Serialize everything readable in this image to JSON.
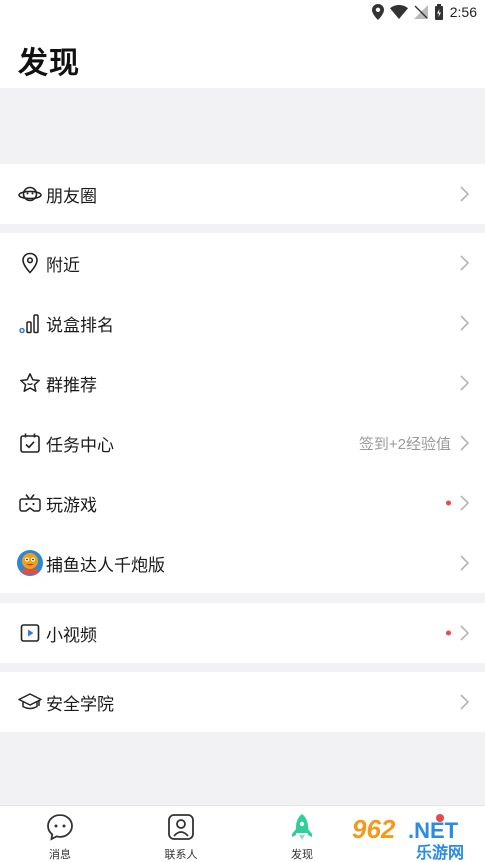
{
  "status_bar": {
    "time": "2:56"
  },
  "header": {
    "title": "发现"
  },
  "sections": [
    {
      "items": [
        {
          "label": "朋友圈",
          "icon": "planet-icon"
        }
      ]
    },
    {
      "items": [
        {
          "label": "附近",
          "icon": "location-pin-icon"
        },
        {
          "label": "说盒排名",
          "icon": "ranking-bars-icon"
        },
        {
          "label": "群推荐",
          "icon": "star-icon"
        },
        {
          "label": "任务中心",
          "icon": "calendar-check-icon",
          "hint": "签到+2经验值"
        },
        {
          "label": "玩游戏",
          "icon": "game-controller-icon",
          "badge": "red-dot"
        },
        {
          "label": "捕鱼达人千炮版",
          "icon": "fishing-game-icon"
        }
      ]
    },
    {
      "items": [
        {
          "label": "小视频",
          "icon": "video-play-icon",
          "badge": "red-dot"
        }
      ]
    },
    {
      "items": [
        {
          "label": "安全学院",
          "icon": "graduation-cap-icon"
        }
      ]
    }
  ],
  "bottom_tabs": [
    {
      "label": "消息",
      "icon": "chat-bubble-icon"
    },
    {
      "label": "联系人",
      "icon": "contact-person-icon"
    },
    {
      "label": "发现",
      "icon": "rocket-icon",
      "active": true
    }
  ],
  "watermark": {
    "text_top": "962.NET",
    "text_bottom": "乐游网"
  },
  "colors": {
    "accent": "#2ecf9a",
    "badge": "#e84a4a",
    "background": "#f2f2f4"
  }
}
